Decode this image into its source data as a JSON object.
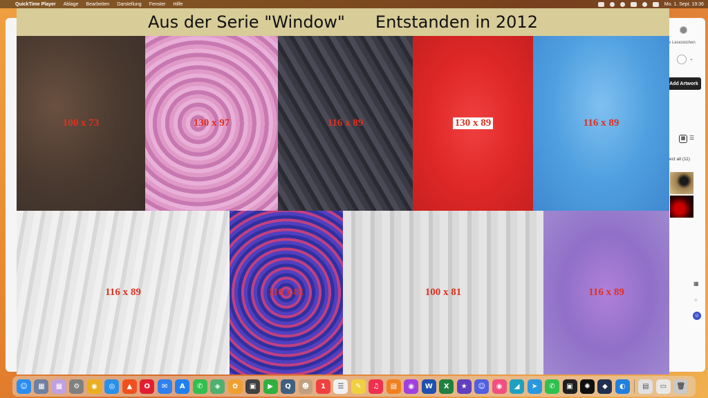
{
  "menubar": {
    "apple": "",
    "app_name": "QuickTime Player",
    "menus": [
      "Ablage",
      "Bearbeiten",
      "Darstellung",
      "Fenster",
      "Hilfe"
    ],
    "clock": "Mo. 1. Sept. 19:36"
  },
  "background_browser": {
    "bookmarks_label": "ille Lesezeichen",
    "add_artwork_label": "Add Artwork",
    "select_all_label": "elect all (11)"
  },
  "qt_window": {
    "title_left": "Aus der Serie \"Window\"",
    "title_right": "Entstanden in 2012",
    "paintings": [
      {
        "label": "100 x 73",
        "color": "#4a3a30"
      },
      {
        "label": "130 x 97",
        "color": "#d890c0"
      },
      {
        "label": "116 x 89",
        "color": "#363640"
      },
      {
        "label": "130 x 89",
        "color": "#e02828"
      },
      {
        "label": "116 x 89",
        "color": "#58a8e8"
      },
      {
        "label": "116 x 89",
        "color": "#e4e4e4"
      },
      {
        "label": "116 x 81",
        "color": "#4838b0"
      },
      {
        "label": "100 x 81",
        "color": "#d8d8d8"
      },
      {
        "label": "116 x 89",
        "color": "#a080d0"
      }
    ]
  },
  "dock": {
    "apps": [
      {
        "name": "finder",
        "glyph": "☺",
        "color": "#2a8ef0"
      },
      {
        "name": "launchpad",
        "glyph": "▦",
        "color": "#7080a0"
      },
      {
        "name": "apps-grid",
        "glyph": "▦",
        "color": "#c0a0e0"
      },
      {
        "name": "system-settings",
        "glyph": "⚙",
        "color": "#808080"
      },
      {
        "name": "chrome",
        "glyph": "◉",
        "color": "#e8b020"
      },
      {
        "name": "safari",
        "glyph": "◎",
        "color": "#2a90e8"
      },
      {
        "name": "brave",
        "glyph": "▲",
        "color": "#f05020"
      },
      {
        "name": "opera",
        "glyph": "O",
        "color": "#e02030"
      },
      {
        "name": "mail",
        "glyph": "✉",
        "color": "#3080f0"
      },
      {
        "name": "app-store",
        "glyph": "A",
        "color": "#2080f0"
      },
      {
        "name": "messages",
        "glyph": "✆",
        "color": "#30c050"
      },
      {
        "name": "maps",
        "glyph": "◈",
        "color": "#50b070"
      },
      {
        "name": "photos",
        "glyph": "✿",
        "color": "#f0a030"
      },
      {
        "name": "photo-app",
        "glyph": "▣",
        "color": "#404040"
      },
      {
        "name": "facetime",
        "glyph": "▶",
        "color": "#30b040"
      },
      {
        "name": "quicktime",
        "glyph": "Q",
        "color": "#406080"
      },
      {
        "name": "contacts",
        "glyph": "☻",
        "color": "#c0a080"
      },
      {
        "name": "calendar",
        "glyph": "1",
        "color": "#f04040"
      },
      {
        "name": "reminders",
        "glyph": "☰",
        "color": "#f0f0f0"
      },
      {
        "name": "notes",
        "glyph": "✎",
        "color": "#f0d040"
      },
      {
        "name": "music",
        "glyph": "♫",
        "color": "#f03050"
      },
      {
        "name": "books",
        "glyph": "▤",
        "color": "#f08020"
      },
      {
        "name": "podcasts",
        "glyph": "◉",
        "color": "#a040e0"
      },
      {
        "name": "word",
        "glyph": "W",
        "color": "#2050b0"
      },
      {
        "name": "excel",
        "glyph": "X",
        "color": "#208040"
      },
      {
        "name": "imovie",
        "glyph": "★",
        "color": "#6040c0"
      },
      {
        "name": "discord",
        "glyph": "☺",
        "color": "#5060e0"
      },
      {
        "name": "screenshot",
        "glyph": "◉",
        "color": "#f05080"
      },
      {
        "name": "vpn",
        "glyph": "◢",
        "color": "#20a0c0"
      },
      {
        "name": "telegram",
        "glyph": "➤",
        "color": "#2a98e0"
      },
      {
        "name": "whatsapp",
        "glyph": "✆",
        "color": "#30c050"
      },
      {
        "name": "terminal",
        "glyph": "▣",
        "color": "#202020"
      },
      {
        "name": "chatgpt",
        "glyph": "✺",
        "color": "#101010"
      },
      {
        "name": "cube-app",
        "glyph": "◆",
        "color": "#203050"
      },
      {
        "name": "arc",
        "glyph": "◐",
        "color": "#2080e0"
      },
      {
        "name": "downloads",
        "glyph": "▤",
        "color": "#e0e0e0"
      },
      {
        "name": "folder",
        "glyph": "▭",
        "color": "#e8e8e8"
      },
      {
        "name": "trash",
        "glyph": "🗑",
        "color": "#c8c8c8"
      }
    ]
  }
}
